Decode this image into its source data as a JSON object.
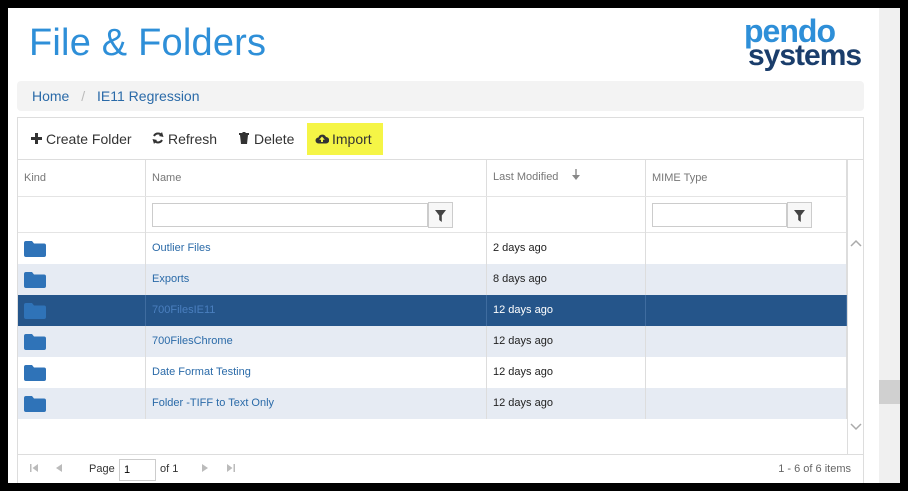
{
  "app": {
    "title": "File & Folders",
    "logo_line1": "pendo",
    "logo_line2": "systems",
    "brand_color": "#2e8fd8",
    "brand_dark": "#1a3d6b"
  },
  "breadcrumb": {
    "items": [
      "Home",
      "IE11 Regression"
    ],
    "separator": "/"
  },
  "toolbar": {
    "create_label": "Create Folder",
    "refresh_label": "Refresh",
    "delete_label": "Delete",
    "import_label": "Import",
    "highlight_color": "#f5f546"
  },
  "grid": {
    "columns": [
      "Kind",
      "Name",
      "Last Modified",
      "MIME Type"
    ],
    "sort_icon": "arrow-down-icon",
    "rows": [
      {
        "kind": "folder-icon",
        "name": "Outlier Files",
        "modified": "2 days ago",
        "mime": ""
      },
      {
        "kind": "folder-icon",
        "name": "Exports",
        "modified": "8 days ago",
        "mime": ""
      },
      {
        "kind": "folder-icon",
        "name": "700FilesIE11",
        "modified": "12 days ago",
        "mime": ""
      },
      {
        "kind": "folder-icon",
        "name": "700FilesChrome",
        "modified": "12 days ago",
        "mime": ""
      },
      {
        "kind": "folder-icon",
        "name": "Date Format Testing",
        "modified": "12 days ago",
        "mime": ""
      },
      {
        "kind": "folder-icon",
        "name": "Folder -TIFF to Text Only",
        "modified": "12 days ago",
        "mime": ""
      }
    ],
    "selected_row": "700FilesIE11",
    "selected_color": "#25558a"
  },
  "pager": {
    "page_label": "Page",
    "page_value": "1",
    "of_label": "of 1",
    "info": "1 - 6 of 6 items"
  }
}
